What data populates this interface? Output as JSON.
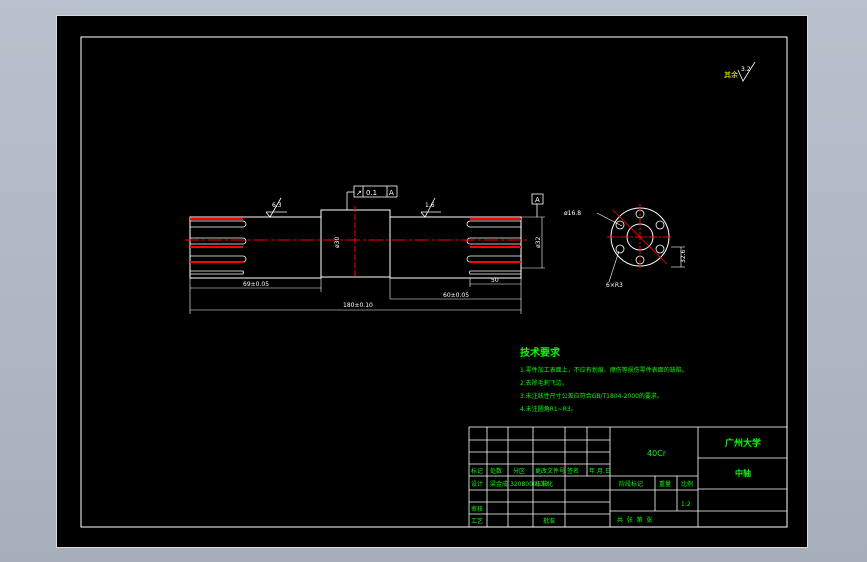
{
  "drawing": {
    "roughness_note": "其余",
    "roughness_note_value": "3.2",
    "roughness_left_value": "6.3",
    "roughness_right_value": "1.6",
    "tolerance_frame": {
      "symbol": "↗",
      "value": "0.1",
      "datum": "A"
    },
    "datum_label": "A",
    "dim_left_length": "69±0.05",
    "dim_total_length": "180±0.10",
    "dim_right_length": "60±0.05",
    "dim_spline_length": "50",
    "dim_center_diameter": "ø30",
    "dim_right_diameter": "ø32",
    "section_hole_dia": "ø16.8",
    "section_width": "32.6",
    "section_pattern": "6×R3"
  },
  "tech_requirements": {
    "title": "技术要求",
    "items": [
      "1.零件加工表面上，不应有划痕、擦伤等损伤零件表面的缺陷。",
      "2.去除毛刺飞边。",
      "3.未注线性尺寸公差应符合GB/T1804-2000的要求。",
      "4.未注圆角R1~R3。"
    ]
  },
  "title_block": {
    "material": "40Cr",
    "school": "广州大学",
    "part_name": "中轴",
    "row_headers": [
      "标记",
      "处数",
      "分区",
      "更改文件号",
      "签名",
      "年.月.日"
    ],
    "design_label": "设计",
    "designer": "梁金成",
    "student_id": "3208000133",
    "standardization_label": "标准化",
    "stage_mark_label": "阶段标记",
    "weight_label": "重量",
    "scale_label": "比例",
    "scale_value": "1:2",
    "review_label": "审核",
    "process_label": "工艺",
    "approve_label": "批准",
    "sheet_info": "共  张  第  张"
  }
}
